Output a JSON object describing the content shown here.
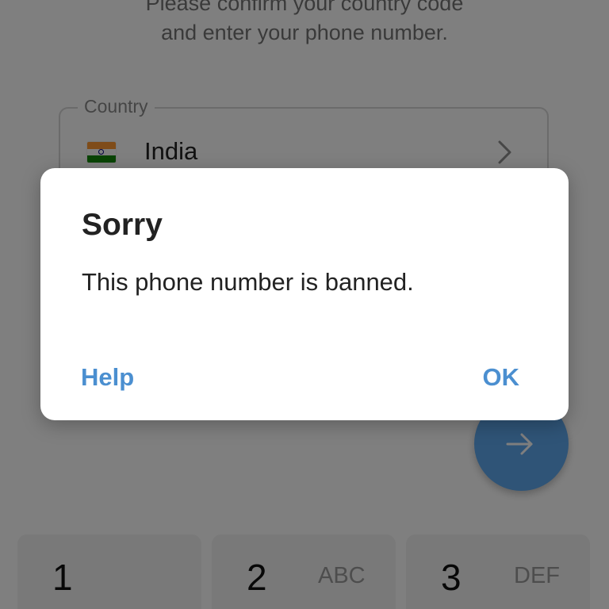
{
  "header": {
    "instruction_line1": "Please confirm your country code",
    "instruction_line2": "and enter your phone number."
  },
  "country_field": {
    "legend": "Country",
    "flag_icon": "india-flag-icon",
    "selected_country": "India",
    "chevron_icon": "chevron-right-icon"
  },
  "next_button": {
    "icon": "arrow-right-icon",
    "color": "#5fa8ee"
  },
  "keypad": {
    "keys": [
      {
        "digit": "1",
        "letters": ""
      },
      {
        "digit": "2",
        "letters": "ABC"
      },
      {
        "digit": "3",
        "letters": "DEF"
      }
    ]
  },
  "dialog": {
    "title": "Sorry",
    "message": "This phone number is banned.",
    "help_label": "Help",
    "ok_label": "OK",
    "accent_color": "#4b8fd0"
  }
}
